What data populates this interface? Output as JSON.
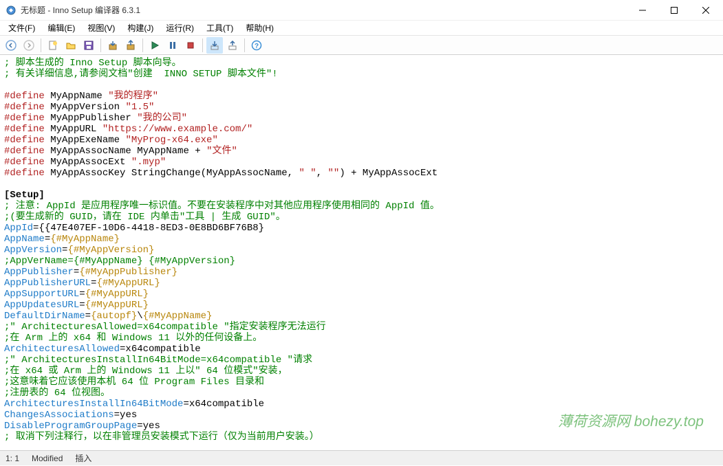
{
  "window": {
    "title": "无标题 - Inno Setup 编译器 6.3.1"
  },
  "menu": {
    "file": "文件(F)",
    "edit": "编辑(E)",
    "view": "视图(V)",
    "build": "构建(J)",
    "run": "运行(R)",
    "tools": "工具(T)",
    "help": "帮助(H)"
  },
  "status": {
    "pos": "1:   1",
    "modified": "Modified",
    "mode": "插入"
  },
  "watermark": "薄荷资源网  bohezy.top",
  "code": [
    {
      "t": "comment",
      "s": "; 脚本生成的 Inno Setup 脚本向导。"
    },
    {
      "t": "comment",
      "s": "; 有关详细信息,请参阅文档\"创建  INNO SETUP 脚本文件\"!"
    },
    {
      "t": "blank",
      "s": ""
    },
    {
      "t": "def",
      "d": "#define",
      "n": " MyAppName ",
      "v": "\"我的程序\""
    },
    {
      "t": "def",
      "d": "#define",
      "n": " MyAppVersion ",
      "v": "\"1.5\""
    },
    {
      "t": "def",
      "d": "#define",
      "n": " MyAppPublisher ",
      "v": "\"我的公司\""
    },
    {
      "t": "def",
      "d": "#define",
      "n": " MyAppURL ",
      "v": "\"https://www.example.com/\""
    },
    {
      "t": "def",
      "d": "#define",
      "n": " MyAppExeName ",
      "v": "\"MyProg-x64.exe\""
    },
    {
      "t": "def2",
      "d": "#define",
      "n": " MyAppAssocName MyAppName + ",
      "v": "\"文件\""
    },
    {
      "t": "def",
      "d": "#define",
      "n": " MyAppAssocExt ",
      "v": "\".myp\""
    },
    {
      "t": "def3",
      "d": "#define",
      "n": " MyAppAssocKey StringChange(MyAppAssocName, ",
      "v1": "\" \"",
      "m": ", ",
      "v2": "\"\"",
      "e": ") + MyAppAssocExt"
    },
    {
      "t": "blank",
      "s": ""
    },
    {
      "t": "section",
      "s": "[Setup]"
    },
    {
      "t": "comment",
      "s": "; 注意: AppId 是应用程序唯一标识值。不要在安装程序中对其他应用程序使用相同的 AppId 值。"
    },
    {
      "t": "comment",
      "s": ";(要生成新的 GUID，请在 IDE 内单击\"工具 | 生成 GUID\"。"
    },
    {
      "t": "kv",
      "k": "AppId",
      "v": "={{47E407EF-10D6-4418-8ED3-0E8BD6BF76B8}"
    },
    {
      "t": "kvc",
      "k": "AppName",
      "p": "=",
      "c": "{#MyAppName}"
    },
    {
      "t": "kvc",
      "k": "AppVersion",
      "p": "=",
      "c": "{#MyAppVersion}"
    },
    {
      "t": "comment",
      "s": ";AppVerName={#MyAppName} {#MyAppVersion}"
    },
    {
      "t": "kvc",
      "k": "AppPublisher",
      "p": "=",
      "c": "{#MyAppPublisher}"
    },
    {
      "t": "kvc",
      "k": "AppPublisherURL",
      "p": "=",
      "c": "{#MyAppURL}"
    },
    {
      "t": "kvc",
      "k": "AppSupportURL",
      "p": "=",
      "c": "{#MyAppURL}"
    },
    {
      "t": "kvc",
      "k": "AppUpdatesURL",
      "p": "=",
      "c": "{#MyAppURL}"
    },
    {
      "t": "kvc2",
      "k": "DefaultDirName",
      "p": "=",
      "c1": "{autopf}",
      "m": "\\",
      "c2": "{#MyAppName}"
    },
    {
      "t": "comment",
      "s": ";\" ArchitecturesAllowed=x64compatible \"指定安装程序无法运行"
    },
    {
      "t": "comment",
      "s": ";在 Arm 上的 x64 和 Windows 11 以外的任何设备上。"
    },
    {
      "t": "kv",
      "k": "ArchitecturesAllowed",
      "v": "=x64compatible"
    },
    {
      "t": "comment",
      "s": ";\" ArchitecturesInstallIn64BitMode=x64compatible \"请求"
    },
    {
      "t": "comment",
      "s": ";在 x64 或 Arm 上的 Windows 11 上以\" 64 位模式\"安装，"
    },
    {
      "t": "comment",
      "s": ";这意味着它应该使用本机 64 位 Program Files 目录和"
    },
    {
      "t": "comment",
      "s": ";注册表的 64 位视图。"
    },
    {
      "t": "kv",
      "k": "ArchitecturesInstallIn64BitMode",
      "v": "=x64compatible"
    },
    {
      "t": "kv",
      "k": "ChangesAssociations",
      "v": "=yes"
    },
    {
      "t": "kv",
      "k": "DisableProgramGroupPage",
      "v": "=yes"
    },
    {
      "t": "comment",
      "s": "; 取消下列注释行，以在非管理员安装模式下运行（仅为当前用户安装。）"
    }
  ]
}
